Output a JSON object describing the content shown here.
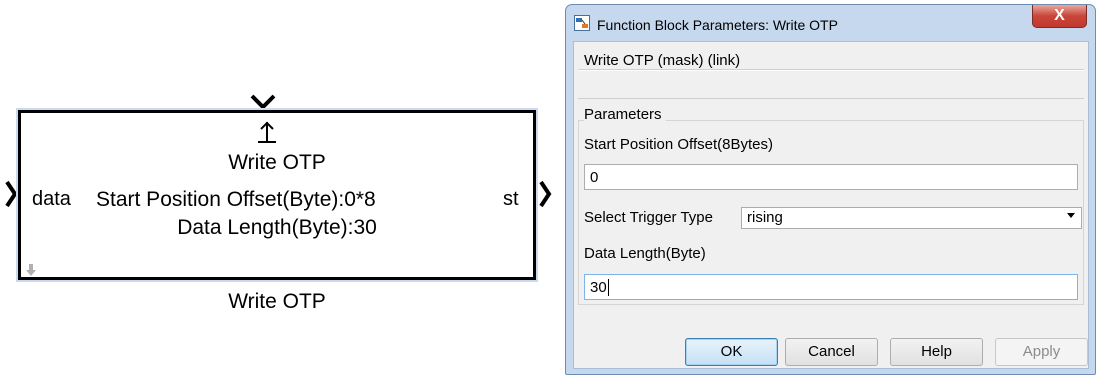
{
  "block": {
    "title": "Write OTP",
    "input_port_label": "data",
    "output_port_label": "st",
    "param_line_1": "Start Position Offset(Byte):0*8",
    "param_line_2": "Data Length(Byte):30",
    "name": "Write OTP",
    "trigger_icon": "rising-edge-icon",
    "port_icon": "chevron-right-icon"
  },
  "dialog": {
    "title": "Function Block Parameters: Write OTP",
    "close_glyph": "X",
    "mask_description": "Write OTP (mask) (link)",
    "group_label": "Parameters",
    "fields": {
      "start_offset_label": "Start Position Offset(8Bytes)",
      "start_offset_value": "0",
      "trigger_label": "Select Trigger Type",
      "trigger_value": "rising",
      "length_label": "Data Length(Byte)",
      "length_value": "30"
    },
    "buttons": {
      "ok": "OK",
      "cancel": "Cancel",
      "help": "Help",
      "apply": "Apply"
    }
  },
  "colors": {
    "frame": "#c5d8ee",
    "close": "#c9453a",
    "client": "#f0f0f0"
  }
}
